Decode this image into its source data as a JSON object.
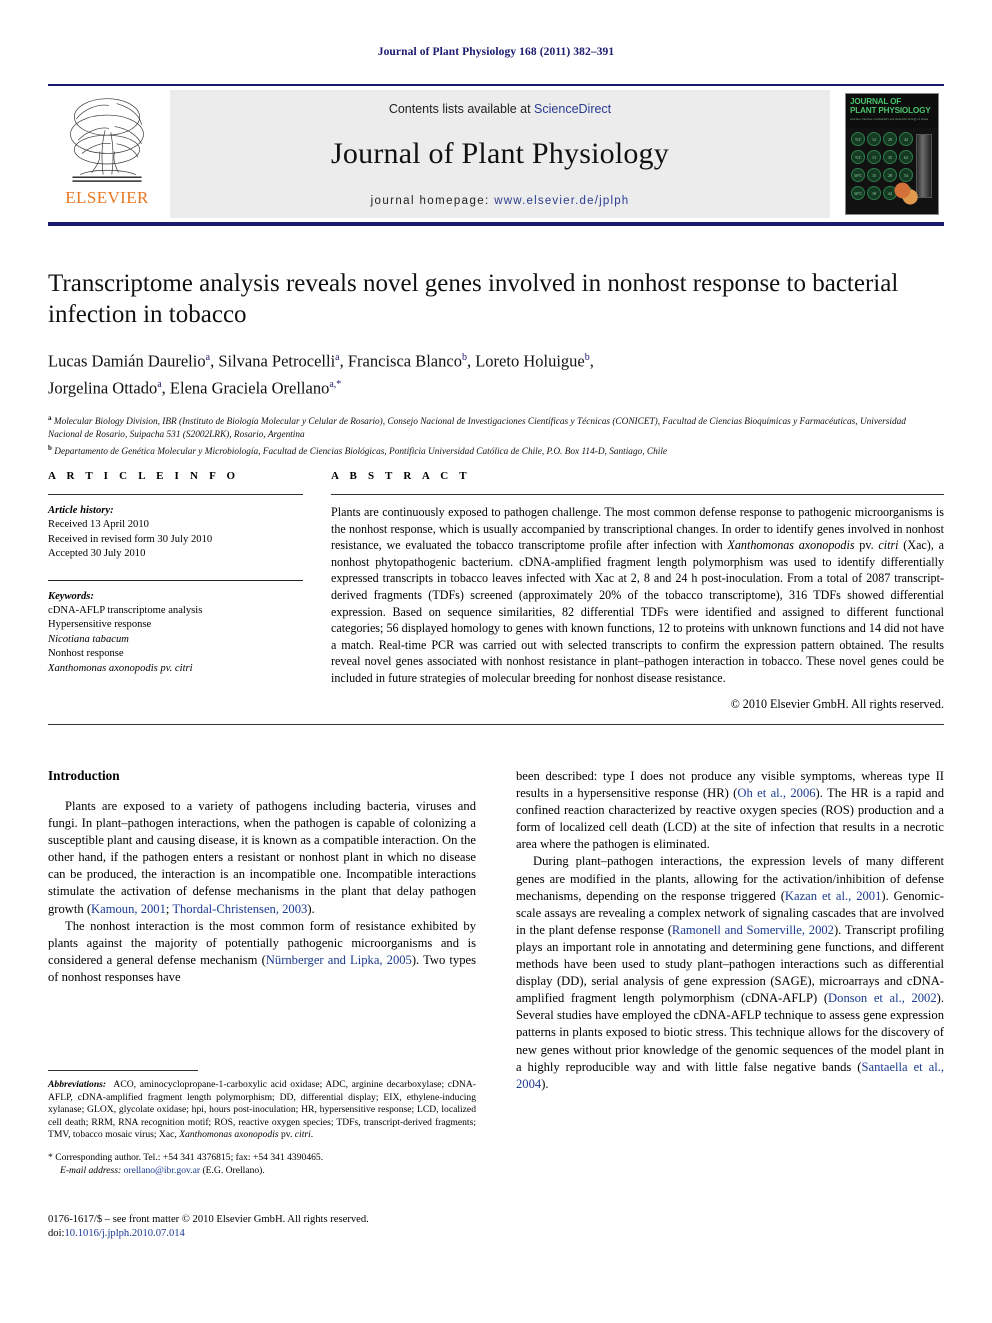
{
  "running_head": "Journal of Plant Physiology 168 (2011) 382–391",
  "masthead": {
    "publisher": "ELSEVIER",
    "contents_prefix": "Contents lists available at ",
    "sciencedirect": "ScienceDirect",
    "journal_name": "Journal of Plant Physiology",
    "homepage_prefix": "journal homepage: ",
    "homepage_url": "www.elsevier.de/jplph",
    "cover": {
      "title_line1": "JOURNAL OF",
      "title_line2": "PLANT PHYSIOLOGY",
      "subtitle": "structure, function, biochemistry and molecular biology of plants",
      "dots": [
        "%T",
        "12",
        "28",
        "42",
        "%T",
        "13",
        "35",
        "62",
        "30°C",
        "15",
        "28",
        "54",
        "30°C",
        "18",
        "44",
        "21",
        "176"
      ]
    }
  },
  "article": {
    "title": "Transcriptome analysis reveals novel genes involved in nonhost response to bacterial infection in tobacco",
    "authors": "Lucas Damián Daurelio a, Silvana Petrocelli a, Francisca Blanco b, Loreto Holuigue b, Jorgelina Ottado a, Elena Graciela Orellano a,*",
    "affiliation_a": "a Molecular Biology Division, IBR (Instituto de Biología Molecular y Celular de Rosario), Consejo Nacional de Investigaciones Científicas y Técnicas (CONICET), Facultad de Ciencias Bioquímicas y Farmacéuticas, Universidad Nacional de Rosario, Suipacha 531 (S2002LRK), Rosario, Argentina",
    "affiliation_b": "b Departamento de Genética Molecular y Microbiología, Facultad de Ciencias Biológicas, Pontificia Universidad Católica de Chile, P.O. Box 114-D, Santiago, Chile"
  },
  "article_info": {
    "heading": "A R T I C L E  I N F O",
    "history_label": "Article history:",
    "history": [
      "Received 13 April 2010",
      "Received in revised form 30 July 2010",
      "Accepted 30 July 2010"
    ],
    "keywords_label": "Keywords:",
    "keywords": [
      "cDNA-AFLP transcriptome analysis",
      "Hypersensitive response",
      "Nicotiana tabacum",
      "Nonhost response",
      "Xanthomonas axonopodis pv. citri"
    ]
  },
  "abstract": {
    "heading": "A B S T R A C T",
    "text": "Plants are continuously exposed to pathogen challenge. The most common defense response to pathogenic microorganisms is the nonhost response, which is usually accompanied by transcriptional changes. In order to identify genes involved in nonhost resistance, we evaluated the tobacco transcriptome profile after infection with Xanthomonas axonopodis pv. citri (Xac), a nonhost phytopathogenic bacterium. cDNA-amplified fragment length polymorphism was used to identify differentially expressed transcripts in tobacco leaves infected with Xac at 2, 8 and 24 h post-inoculation. From a total of 2087 transcript-derived fragments (TDFs) screened (approximately 20% of the tobacco transcriptome), 316 TDFs showed differential expression. Based on sequence similarities, 82 differential TDFs were identified and assigned to different functional categories; 56 displayed homology to genes with known functions, 12 to proteins with unknown functions and 14 did not have a match. Real-time PCR was carried out with selected transcripts to confirm the expression pattern obtained. The results reveal novel genes associated with nonhost resistance in plant–pathogen interaction in tobacco. These novel genes could be included in future strategies of molecular breeding for nonhost disease resistance.",
    "copyright": "© 2010 Elsevier GmbH. All rights reserved."
  },
  "introduction": {
    "heading": "Introduction",
    "left_paragraphs": [
      "Plants are exposed to a variety of pathogens including bacteria, viruses and fungi. In plant–pathogen interactions, when the pathogen is capable of colonizing a susceptible plant and causing disease, it is known as a compatible interaction. On the other hand, if the pathogen enters a resistant or nonhost plant in which no disease can be produced, the interaction is an incompatible one. Incompatible interactions stimulate the activation of defense mechanisms in the plant that delay pathogen growth (Kamoun, 2001; Thordal-Christensen, 2003).",
      "The nonhost interaction is the most common form of resistance exhibited by plants against the majority of potentially pathogenic microorganisms and is considered a general defense mechanism (Nürnberger and Lipka, 2005). Two types of nonhost responses have"
    ],
    "right_paragraphs": [
      "been described: type I does not produce any visible symptoms, whereas type II results in a hypersensitive response (HR) (Oh et al., 2006). The HR is a rapid and confined reaction characterized by reactive oxygen species (ROS) production and a form of localized cell death (LCD) at the site of infection that results in a necrotic area where the pathogen is eliminated.",
      "During plant–pathogen interactions, the expression levels of many different genes are modified in the plants, allowing for the activation/inhibition of defense mechanisms, depending on the response triggered (Kazan et al., 2001). Genomic-scale assays are revealing a complex network of signaling cascades that are involved in the plant defense response (Ramonell and Somerville, 2002). Transcript profiling plays an important role in annotating and determining gene functions, and different methods have been used to study plant–pathogen interactions such as differential display (DD), serial analysis of gene expression (SAGE), microarrays and cDNA-amplified fragment length polymorphism (cDNA-AFLP) (Donson et al., 2002). Several studies have employed the cDNA-AFLP technique to assess gene expression patterns in plants exposed to biotic stress. This technique allows for the discovery of new genes without prior knowledge of the genomic sequences of the model plant in a highly reproducible way and with little false negative bands (Santaella et al., 2004)."
    ]
  },
  "footnotes": {
    "abbrev_label": "Abbreviations:",
    "abbrev_text": "ACO, aminocyclopropane-1-carboxylic acid oxidase; ADC, arginine decarboxylase; cDNA-AFLP, cDNA-amplified fragment length polymorphism; DD, differential display; EIX, ethylene-inducing xylanase; GLOX, glycolate oxidase; hpi, hours post-inoculation; HR, hypersensitive response; LCD, localized cell death; RRM, RNA recognition motif; ROS, reactive oxygen species; TDFs, transcript-derived fragments; TMV, tobacco mosaic virus; Xac, Xanthomonas axonopodis pv. citri.",
    "corresponding": "* Corresponding author. Tel.: +54 341 4376815; fax: +54 341 4390465.",
    "email_label": "E-mail address:",
    "email": "orellano@ibr.gov.ar",
    "email_suffix": "(E.G. Orellano).",
    "issn_line": "0176-1617/$ – see front matter © 2010 Elsevier GmbH. All rights reserved.",
    "doi_label": "doi:",
    "doi": "10.1016/j.jplph.2010.07.014"
  },
  "colors": {
    "journal_blue": "#1a1a6e",
    "link_blue": "#1a3a8f",
    "elsevier_orange": "#E87722",
    "band_gray": "#ececec"
  }
}
